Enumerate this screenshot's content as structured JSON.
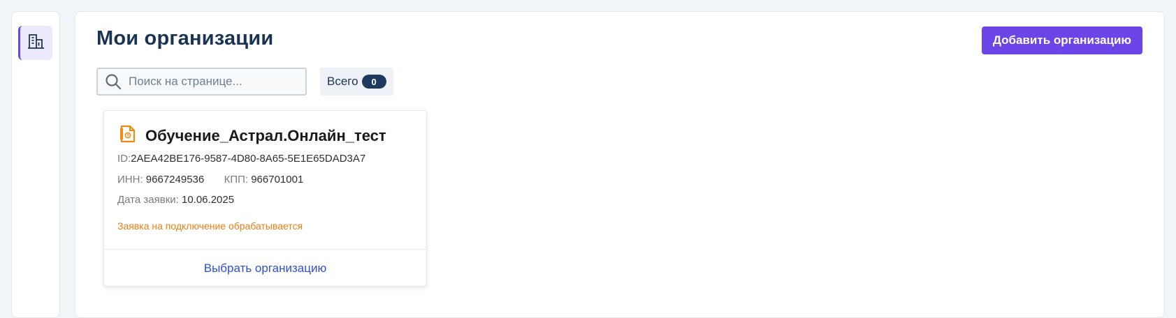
{
  "sidebar": {
    "items": [
      {
        "icon": "organization-building-icon",
        "active": true
      }
    ]
  },
  "header": {
    "title": "Мои организации",
    "add_button_label": "Добавить организацию"
  },
  "search": {
    "placeholder": "Поиск на странице...",
    "value": ""
  },
  "total": {
    "label": "Всего",
    "count": "0"
  },
  "organizations": [
    {
      "icon": "document-icon",
      "name": "Обучение_Астрал.Онлайн_тест",
      "id_label": "ID:",
      "id_value": "2AEA42BE176-9587-4D80-8A65-5E1E65DAD3A7",
      "inn_label": "ИНН:",
      "inn_value": "9667249536",
      "kpp_label": "КПП:",
      "kpp_value": "966701001",
      "date_label": "Дата заявки:",
      "date_value": "10.06.2025",
      "status": "Заявка на подключение обрабатывается",
      "select_label": "Выбрать организацию"
    }
  ],
  "colors": {
    "accent": "#6b45e8",
    "title": "#1b3352",
    "status_warning": "#f07d10",
    "link": "#2e4fd0",
    "badge": "#1e3a5f",
    "document_icon": "#f28a12"
  }
}
